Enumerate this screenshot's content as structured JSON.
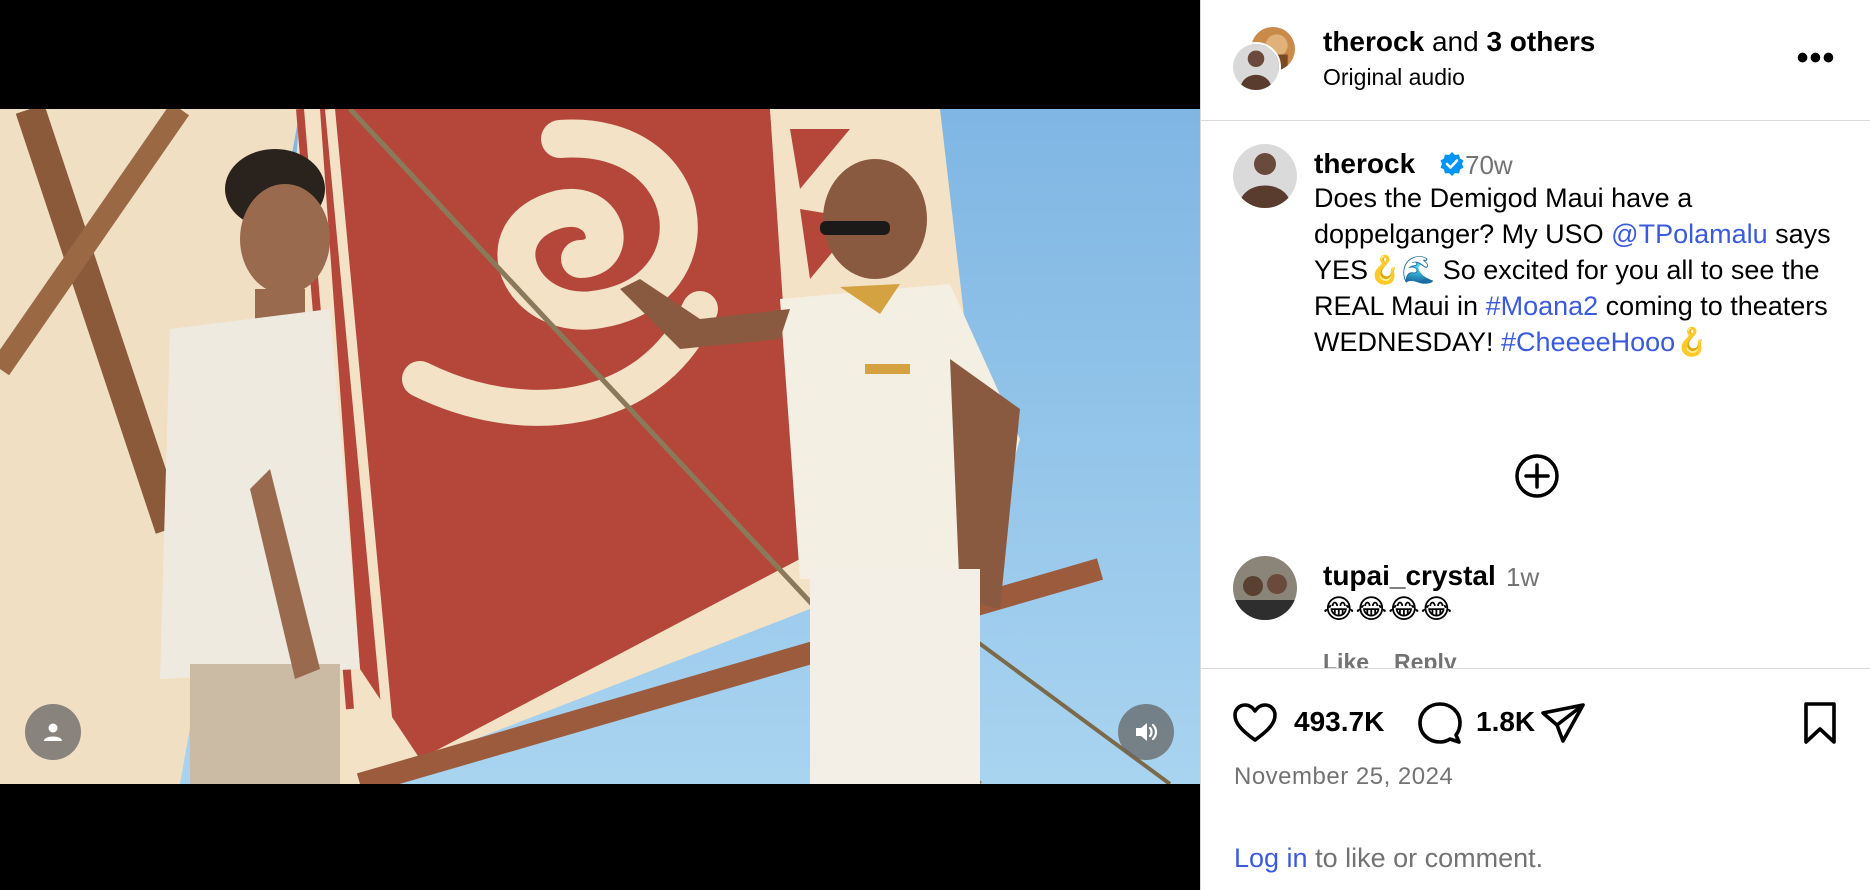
{
  "header": {
    "username": "therock",
    "others_connector": "and",
    "others": "3 others",
    "audio": "Original audio",
    "more_label": "•••"
  },
  "caption": {
    "username": "therock",
    "verified": true,
    "time": "70w",
    "text_1": "Does the Demigod Maui have a doppelganger? My USO ",
    "mention": "@TPolamalu",
    "text_2": " says YES🪝🌊   So excited for you all to see the REAL Maui in ",
    "hashtag_1": "#Moana2",
    "text_3": " coming to theaters WEDNESDAY! ",
    "hashtag_2": "#CheeeeHooo🪝"
  },
  "comment": {
    "username": "tupai_crystal",
    "time": "1w",
    "text": "😂😂😂😂",
    "like_label": "Like",
    "reply_label": "Reply"
  },
  "actions": {
    "likes": "493.7K",
    "comments": "1.8K",
    "date": "November 25, 2024"
  },
  "login": {
    "link_text": "Log in",
    "rest": " to like or comment."
  },
  "icons": {
    "user_tag": "person-icon",
    "audio": "speaker-icon",
    "add": "plus-circle-icon",
    "like": "heart-icon",
    "comment": "speech-bubble-icon",
    "share": "paper-plane-icon",
    "save": "bookmark-icon",
    "verified": "verified-badge-icon"
  },
  "colors": {
    "link": "#3a5be0",
    "verified": "#0095f6",
    "muted": "#737373",
    "sail_red": "#b5473a",
    "sail_cream": "#f1dfc3",
    "sky": "#8fc3e8"
  }
}
